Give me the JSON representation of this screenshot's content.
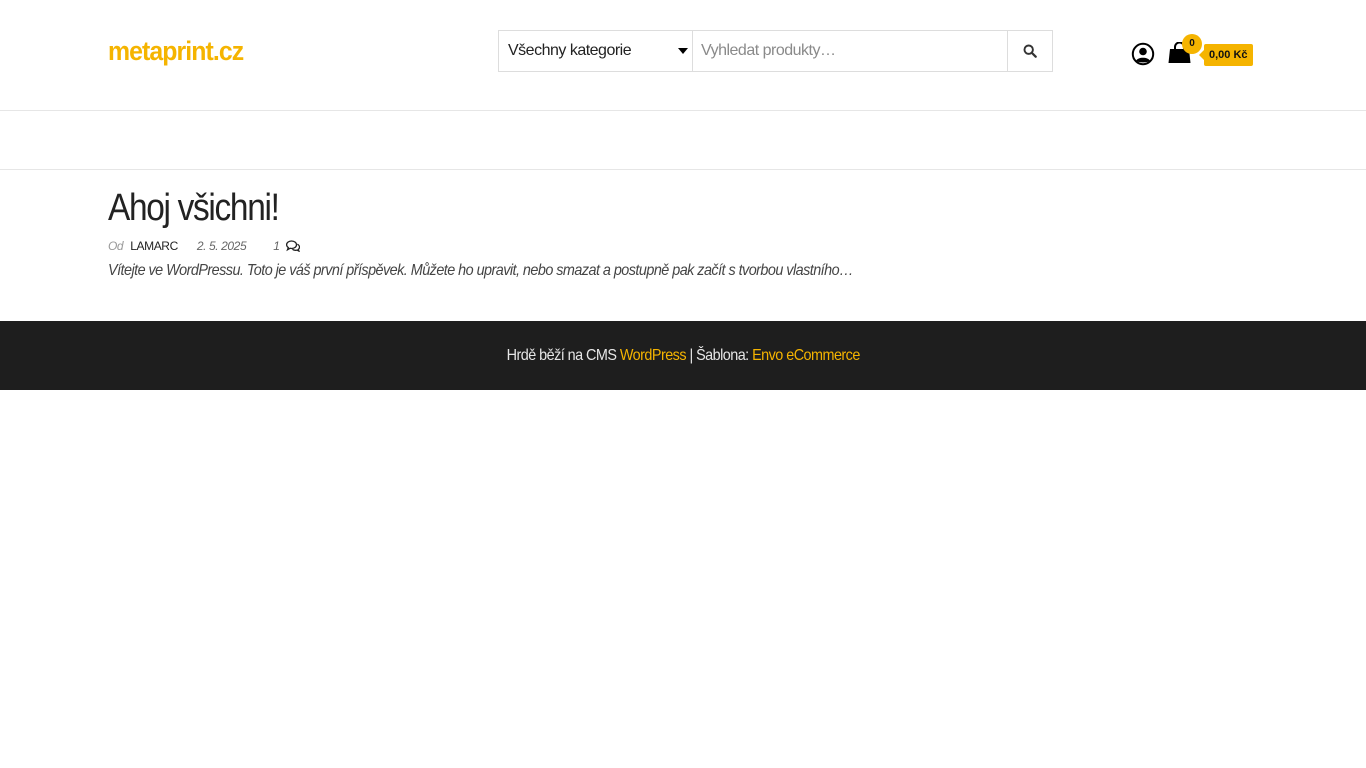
{
  "site": {
    "title": "metaprint.cz",
    "accent_color": "#f5b400"
  },
  "search": {
    "category_selected": "Všechny kategorie",
    "placeholder": "Vyhledat produkty…",
    "button_icon": "search-icon"
  },
  "header_icons": {
    "account_icon": "user-circle-icon",
    "cart_icon": "shopping-bag-icon",
    "cart_count": "0",
    "cart_total": "0,00 Kč"
  },
  "post": {
    "title": "Ahoj všichni!",
    "by_label": "Od",
    "author": "lamarc",
    "date": "2. 5. 2025",
    "comments_count": "1",
    "comments_icon": "comments-icon",
    "excerpt": "Vítejte ve WordPressu. Toto je váš první příspěvek. Můžete ho upravit, nebo smazat a postupně pak začít s tvorbou vlastního…"
  },
  "footer": {
    "text_before": "Hrdě běží na CMS ",
    "cms_link": "WordPress",
    "separator": " | Šablona: ",
    "theme_link": "Envo eCommerce",
    "background": "#1e1e1e"
  }
}
